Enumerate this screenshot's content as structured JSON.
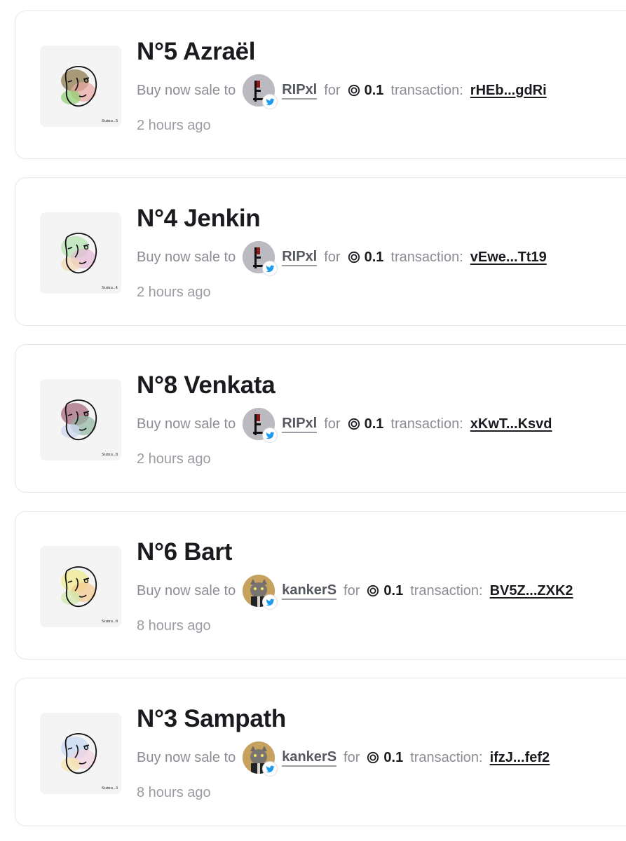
{
  "sales": [
    {
      "title": "N°5 Azraël",
      "sale_text": "Buy now sale to",
      "buyer": "RIPxl",
      "buyer_avatar": "pixel-figure-avatar",
      "for_text": "for",
      "currency_icon": "coin-icon",
      "price": "0.1",
      "tx_label": "transaction:",
      "tx_id": "rHEb...gdRi",
      "time": "2 hours ago",
      "signature": "Sumu..5",
      "palette": [
        "#8f7b4f",
        "#e9a6a0",
        "#8fcf6f"
      ]
    },
    {
      "title": "N°4 Jenkin",
      "sale_text": "Buy now sale to",
      "buyer": "RIPxl",
      "buyer_avatar": "pixel-figure-avatar",
      "for_text": "for",
      "currency_icon": "coin-icon",
      "price": "0.1",
      "tx_label": "transaction:",
      "tx_id": "vEwe...Tt19",
      "time": "2 hours ago",
      "signature": "Sumu..4",
      "palette": [
        "#b6e3b0",
        "#e7b6d8",
        "#f2d7b0"
      ]
    },
    {
      "title": "N°8 Venkata",
      "sale_text": "Buy now sale to",
      "buyer": "RIPxl",
      "buyer_avatar": "pixel-figure-avatar",
      "for_text": "for",
      "currency_icon": "coin-icon",
      "price": "0.1",
      "tx_label": "transaction:",
      "tx_id": "xKwT...Ksvd",
      "time": "2 hours ago",
      "signature": "Sumu..8",
      "palette": [
        "#a86a7c",
        "#8fb3a0",
        "#c9d6ef"
      ]
    },
    {
      "title": "N°6 Bart",
      "sale_text": "Buy now sale to",
      "buyer": "kankerS",
      "buyer_avatar": "cat-avatar",
      "for_text": "for",
      "currency_icon": "coin-icon",
      "price": "0.1",
      "tx_label": "transaction:",
      "tx_id": "BV5Z...ZXK2",
      "time": "8 hours ago",
      "signature": "Sumu..6",
      "palette": [
        "#f1ea8f",
        "#f3c98f",
        "#cfe8a6"
      ]
    },
    {
      "title": "N°3 Sampath",
      "sale_text": "Buy now sale to",
      "buyer": "kankerS",
      "buyer_avatar": "cat-avatar",
      "for_text": "for",
      "currency_icon": "coin-icon",
      "price": "0.1",
      "tx_label": "transaction:",
      "tx_id": "ifzJ...fef2",
      "time": "8 hours ago",
      "signature": "Sumu..3",
      "palette": [
        "#c8d8f2",
        "#f2d1e1",
        "#f3e2a9"
      ]
    }
  ],
  "colors": {
    "card_border": "#e6e7ea",
    "title": "#1a1b1f",
    "muted": "#8a8d93",
    "link": "#1a1b1f",
    "twitter_badge": "#1d9bf0"
  }
}
